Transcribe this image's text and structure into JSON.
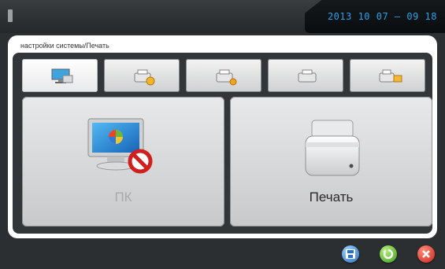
{
  "header": {
    "logo_text": "",
    "datetime": "2013 10 07 — 09 18"
  },
  "breadcrumb": "настройки системы/Печать",
  "tabs": [
    {
      "name": "pc-settings",
      "icon": "monitor-icon",
      "active": true
    },
    {
      "name": "printer-settings",
      "icon": "printer-icon",
      "active": false
    },
    {
      "name": "printer-share",
      "icon": "printer-share-icon",
      "active": false
    },
    {
      "name": "printer-plain",
      "icon": "printer-icon",
      "active": false
    },
    {
      "name": "printer-network",
      "icon": "printer-network-icon",
      "active": false
    }
  ],
  "main": {
    "pc_label": "ПК",
    "print_label": "Печать"
  },
  "footer": {
    "buttons": [
      "save-icon",
      "refresh-icon",
      "close-icon"
    ]
  },
  "colors": {
    "accent_clock": "#2aa0e6",
    "background": "#2c2f31",
    "panel": "#ffffff"
  }
}
